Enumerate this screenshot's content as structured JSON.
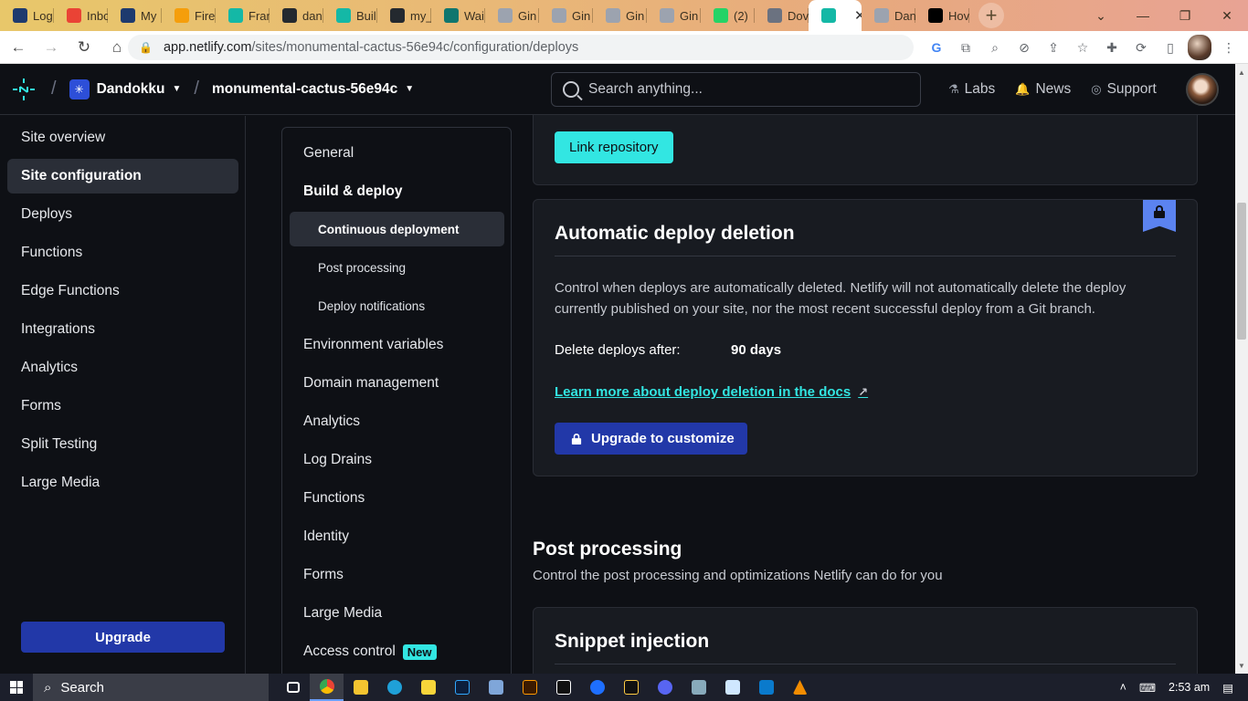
{
  "browser": {
    "tabs": [
      {
        "label": "Log",
        "color": "#1e3a6e"
      },
      {
        "label": "Inbo",
        "color": "#ea4335"
      },
      {
        "label": "My",
        "color": "#1e3a6e"
      },
      {
        "label": "Fire",
        "color": "#f59e0b"
      },
      {
        "label": "Fran",
        "color": "#14b8a6"
      },
      {
        "label": "dan",
        "color": "#24292f"
      },
      {
        "label": "Buil",
        "color": "#14b8a6"
      },
      {
        "label": "my_",
        "color": "#24292f"
      },
      {
        "label": "Wai",
        "color": "#0f766e"
      },
      {
        "label": "Gin",
        "color": "#9ca3af"
      },
      {
        "label": "Gin",
        "color": "#9ca3af"
      },
      {
        "label": "Gin",
        "color": "#9ca3af"
      },
      {
        "label": "Gin",
        "color": "#9ca3af"
      },
      {
        "label": "(2)",
        "color": "#25d366"
      },
      {
        "label": "Dov",
        "color": "#6b7280"
      },
      {
        "label": "",
        "color": "#14b8a6",
        "active": true
      },
      {
        "label": "Dan",
        "color": "#9ca3af"
      },
      {
        "label": "Hov",
        "color": "#000000"
      }
    ],
    "url_host": "app.netlify.com",
    "url_path": "/sites/monumental-cactus-56e94c/configuration/deploys"
  },
  "header": {
    "team": "Dandokku",
    "site": "monumental-cactus-56e94c",
    "search_placeholder": "Search anything...",
    "links": [
      "Labs",
      "News",
      "Support"
    ]
  },
  "sidebar": {
    "items": [
      "Site overview",
      "Site configuration",
      "Deploys",
      "Functions",
      "Edge Functions",
      "Integrations",
      "Analytics",
      "Forms",
      "Split Testing",
      "Large Media"
    ],
    "selected": 1,
    "upgrade_label": "Upgrade"
  },
  "settings_nav": {
    "general": "General",
    "build_deploy": "Build & deploy",
    "sub": [
      "Continuous deployment",
      "Post processing",
      "Deploy notifications"
    ],
    "items": [
      "Environment variables",
      "Domain management",
      "Analytics",
      "Log Drains",
      "Functions",
      "Identity",
      "Forms",
      "Large Media",
      "Access control"
    ],
    "new_badge": "New"
  },
  "main": {
    "link_repo_label": "Link repository",
    "auto_delete": {
      "title": "Automatic deploy deletion",
      "description": "Control when deploys are automatically deleted. Netlify will not automatically delete the deploy currently published on your site, nor the most recent successful deploy from a Git branch.",
      "key": "Delete deploys after:",
      "value": "90 days",
      "doc_link": "Learn more about deploy deletion in the docs",
      "upgrade_button": "Upgrade to customize"
    },
    "post_processing": {
      "title": "Post processing",
      "description": "Control the post processing and optimizations Netlify can do for you"
    },
    "snippet_title": "Snippet injection"
  },
  "taskbar": {
    "search": "Search",
    "time": "2:53 am"
  }
}
